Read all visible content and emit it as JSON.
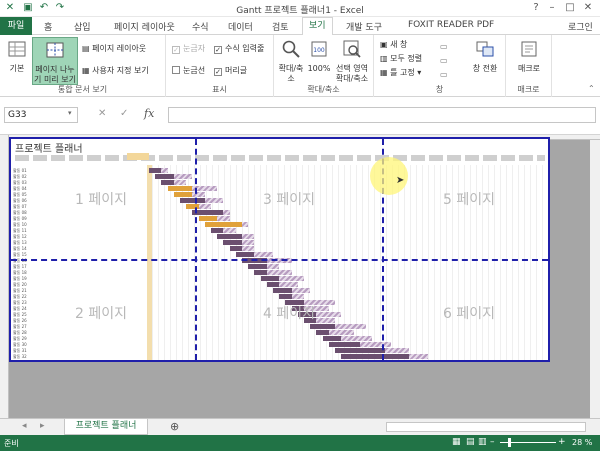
{
  "window": {
    "title": "Gantt 프로젝트 플래너1 - Excel",
    "signin": "로그인"
  },
  "tabs": [
    "파일",
    "홈",
    "삽입",
    "페이지 레이아웃",
    "수식",
    "데이터",
    "검토",
    "보기",
    "개발 도구",
    "FOXIT READER PDF"
  ],
  "active_tab": "보기",
  "ribbon": {
    "workbook_views": {
      "label": "통합 문서 보기",
      "normal": "기본",
      "page_break": "페이지 나누기 미리 보기",
      "page_layout": "페이지 레이아웃",
      "custom_views": "사용자 지정 보기"
    },
    "show": {
      "label": "표시",
      "ruler": "눈금자",
      "formula_bar": "수식 입력줄",
      "gridlines": "눈금선",
      "headings": "머리글"
    },
    "zoom": {
      "label": "확대/축소",
      "zoom": "확대/축소",
      "hundred": "100%",
      "to_selection": "선택 영역 확대/축소"
    },
    "window": {
      "label": "창",
      "new_window": "새 창",
      "arrange_all": "모두 정렬",
      "freeze": "틀 고정",
      "switch": "창 전환"
    },
    "macros": {
      "label": "매크로",
      "macros": "매크로"
    }
  },
  "formula_bar": {
    "name_box": "G33",
    "fx": "fx",
    "value": ""
  },
  "sheet": {
    "title": "프로젝트 플래너",
    "page_labels": [
      "1 페이지",
      "2 페이지",
      "3 페이지",
      "4 페이지",
      "5 페이지",
      "6 페이지"
    ],
    "row_labels": [
      "활동 01",
      "활동 02",
      "활동 03",
      "활동 04",
      "활동 05",
      "활동 06",
      "활동 07",
      "활동 08",
      "활동 09",
      "활동 10",
      "활동 11",
      "활동 12",
      "활동 13",
      "활동 14",
      "활동 15",
      "활동 16",
      "활동 17",
      "활동 18",
      "활동 19",
      "활동 20",
      "활동 21",
      "활동 22",
      "활동 23",
      "활동 24",
      "활동 25",
      "활동 26",
      "활동 27",
      "활동 28",
      "활동 29",
      "활동 30",
      "활동 31",
      "활동 32"
    ],
    "bars": [
      {
        "start": 0,
        "plan": 3,
        "actual": 2,
        "kind": "actual"
      },
      {
        "start": 1,
        "plan": 6,
        "actual": 3,
        "kind": "actual"
      },
      {
        "start": 2,
        "plan": 4,
        "actual": 2,
        "kind": "actual"
      },
      {
        "start": 3,
        "plan": 8,
        "actual": 4,
        "kind": "over"
      },
      {
        "start": 4,
        "plan": 5,
        "actual": 3,
        "kind": "over"
      },
      {
        "start": 5,
        "plan": 7,
        "actual": 4,
        "kind": "actual"
      },
      {
        "start": 6,
        "plan": 4,
        "actual": 2,
        "kind": "over"
      },
      {
        "start": 7,
        "plan": 6,
        "actual": 5,
        "kind": "actual"
      },
      {
        "start": 8,
        "plan": 5,
        "actual": 3,
        "kind": "over"
      },
      {
        "start": 9,
        "plan": 7,
        "actual": 6,
        "kind": "over"
      },
      {
        "start": 10,
        "plan": 4,
        "actual": 2,
        "kind": "actual"
      },
      {
        "start": 11,
        "plan": 6,
        "actual": 4,
        "kind": "actual"
      },
      {
        "start": 12,
        "plan": 5,
        "actual": 3,
        "kind": "actual"
      },
      {
        "start": 13,
        "plan": 4,
        "actual": 2,
        "kind": "actual"
      },
      {
        "start": 14,
        "plan": 6,
        "actual": 3,
        "kind": "actual"
      },
      {
        "start": 15,
        "plan": 8,
        "actual": 4,
        "kind": "actual"
      },
      {
        "start": 16,
        "plan": 5,
        "actual": 3,
        "kind": "actual"
      },
      {
        "start": 17,
        "plan": 6,
        "actual": 2,
        "kind": "actual"
      },
      {
        "start": 18,
        "plan": 7,
        "actual": 3,
        "kind": "actual"
      },
      {
        "start": 19,
        "plan": 5,
        "actual": 2,
        "kind": "actual"
      },
      {
        "start": 20,
        "plan": 6,
        "actual": 3,
        "kind": "actual"
      },
      {
        "start": 21,
        "plan": 4,
        "actual": 2,
        "kind": "actual"
      },
      {
        "start": 22,
        "plan": 8,
        "actual": 3,
        "kind": "actual"
      },
      {
        "start": 23,
        "plan": 6,
        "actual": 2,
        "kind": "actual"
      },
      {
        "start": 24,
        "plan": 7,
        "actual": 3,
        "kind": "actual"
      },
      {
        "start": 25,
        "plan": 5,
        "actual": 2,
        "kind": "actual"
      },
      {
        "start": 26,
        "plan": 9,
        "actual": 4,
        "kind": "actual"
      },
      {
        "start": 27,
        "plan": 6,
        "actual": 2,
        "kind": "actual"
      },
      {
        "start": 28,
        "plan": 8,
        "actual": 3,
        "kind": "actual"
      },
      {
        "start": 29,
        "plan": 10,
        "actual": 5,
        "kind": "actual"
      },
      {
        "start": 30,
        "plan": 12,
        "actual": 8,
        "kind": "actual"
      },
      {
        "start": 31,
        "plan": 14,
        "actual": 11,
        "kind": "actual"
      }
    ]
  },
  "sheet_tab": "프로젝트 플래너",
  "status": {
    "ready": "준비",
    "zoom": "28 %"
  },
  "colors": {
    "excel_green": "#217346",
    "page_border": "#1f1faa",
    "plan": "#b79cc0",
    "actual": "#6b4f6f",
    "over": "#e0a13a"
  }
}
